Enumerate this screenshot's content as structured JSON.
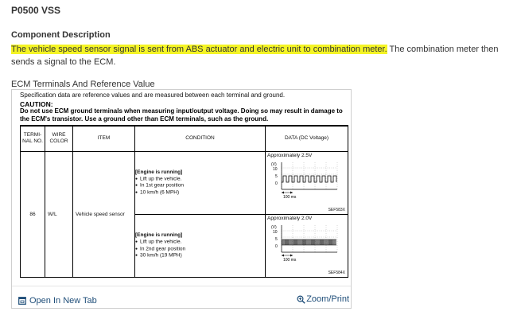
{
  "page": {
    "dtc_title": "P0500 VSS",
    "component_heading": "Component Description",
    "description_highlight": "The vehicle speed sensor signal is sent from ABS actuator and electric unit to combination meter.",
    "description_rest": " The combination meter then sends a signal to the ECM.",
    "ecm_heading": "ECM Terminals And Reference Value"
  },
  "card": {
    "spec_note": "Specification data are reference values and are measured between each terminal and ground.",
    "caution_title": "CAUTION:",
    "caution_text": "Do not use ECM ground terminals when measuring input/output voltage. Doing so may result in damage to the ECM's transistor. Use a ground other than ECM terminals, such as the ground.",
    "table": {
      "headers": {
        "terminal": "TERMI-NAL NO.",
        "wire_color": "WIRE COLOR",
        "item": "ITEM",
        "condition": "CONDITION",
        "data": "DATA (DC Voltage)"
      },
      "row": {
        "terminal_no": "86",
        "wire_color": "W/L",
        "item": "Vehicle speed sensor"
      },
      "conditions": [
        {
          "heading": "[Engine is running]",
          "bullets": [
            "Lift up the vehicle.",
            "In 1st gear position",
            "10 km/h (6 MPH)"
          ],
          "data_value": "Approximately 2.5V",
          "scope_unit": "(V)",
          "scope_ticks": [
            "10",
            "5",
            "0"
          ],
          "scope_time": "100 ms",
          "figure_id": "SEF583X"
        },
        {
          "heading": "[Engine is running]",
          "bullets": [
            "Lift up the vehicle.",
            "In 2nd gear position",
            "30 km/h (19 MPH)"
          ],
          "data_value": "Approximately 2.0V",
          "scope_unit": "(V)",
          "scope_ticks": [
            "10",
            "5",
            "0"
          ],
          "scope_time": "100 ms",
          "figure_id": "SEF584X"
        }
      ]
    },
    "open_tab_label": "Open In New Tab",
    "zoom_label": "Zoom/Print",
    "link_color": "#1f4e79",
    "highlight_color": "#f4f425"
  }
}
